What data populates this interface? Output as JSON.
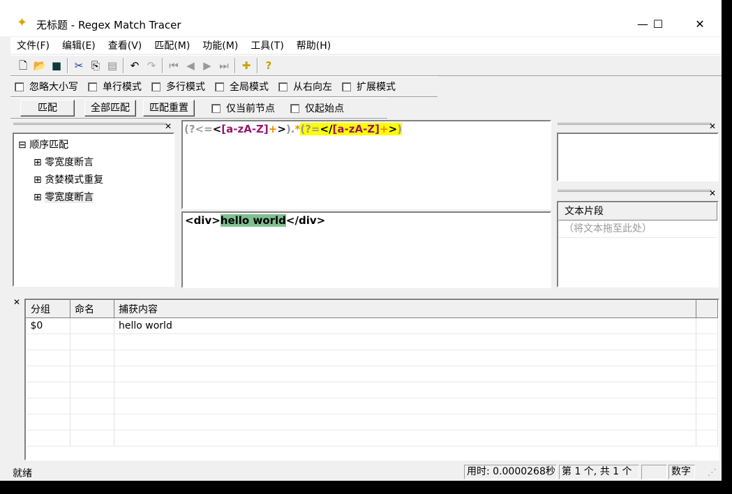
{
  "window": {
    "title": "无标题 - Regex Match Tracer",
    "minimize": "—",
    "maximize": "☐",
    "close": "✕"
  },
  "menu": [
    "文件(F)",
    "编辑(E)",
    "查看(V)",
    "匹配(M)",
    "功能(M)",
    "工具(T)",
    "帮助(H)"
  ],
  "options": [
    "忽略大小写",
    "单行模式",
    "多行模式",
    "全局模式",
    "从右向左",
    "扩展模式"
  ],
  "actions": {
    "match": "匹配",
    "match_all": "全部匹配",
    "reset": "匹配重置",
    "current_node": "仅当前节点",
    "start_only": "仅起始点"
  },
  "tree": {
    "root": "顺序匹配",
    "children": [
      "零宽度断言",
      "贪婪模式重复",
      "零宽度断言"
    ]
  },
  "regex": {
    "p1": "(?<=",
    "p2": "<",
    "p3": "[a-zA-Z]",
    "p4": "+",
    "p5": ">",
    "p6": ").",
    "p7": "*",
    "p8": "(?=",
    "p9": "</",
    "p10": "[a-zA-Z]",
    "p11": "+",
    "p12": ">",
    "p13": ")"
  },
  "text": {
    "before": "<div>",
    "match": "hello world",
    "after": "</div>"
  },
  "snippets": {
    "header": "文本片段",
    "placeholder": "（将文本拖至此处）"
  },
  "results": {
    "columns": [
      "分组",
      "命名",
      "捕获内容"
    ],
    "rows": [
      [
        "$0",
        "",
        "hello world"
      ]
    ]
  },
  "status": {
    "ready": "就绪",
    "time": "用时: 0.0000268秒",
    "count": "第 1 个, 共 1 个",
    "num": "数字"
  }
}
